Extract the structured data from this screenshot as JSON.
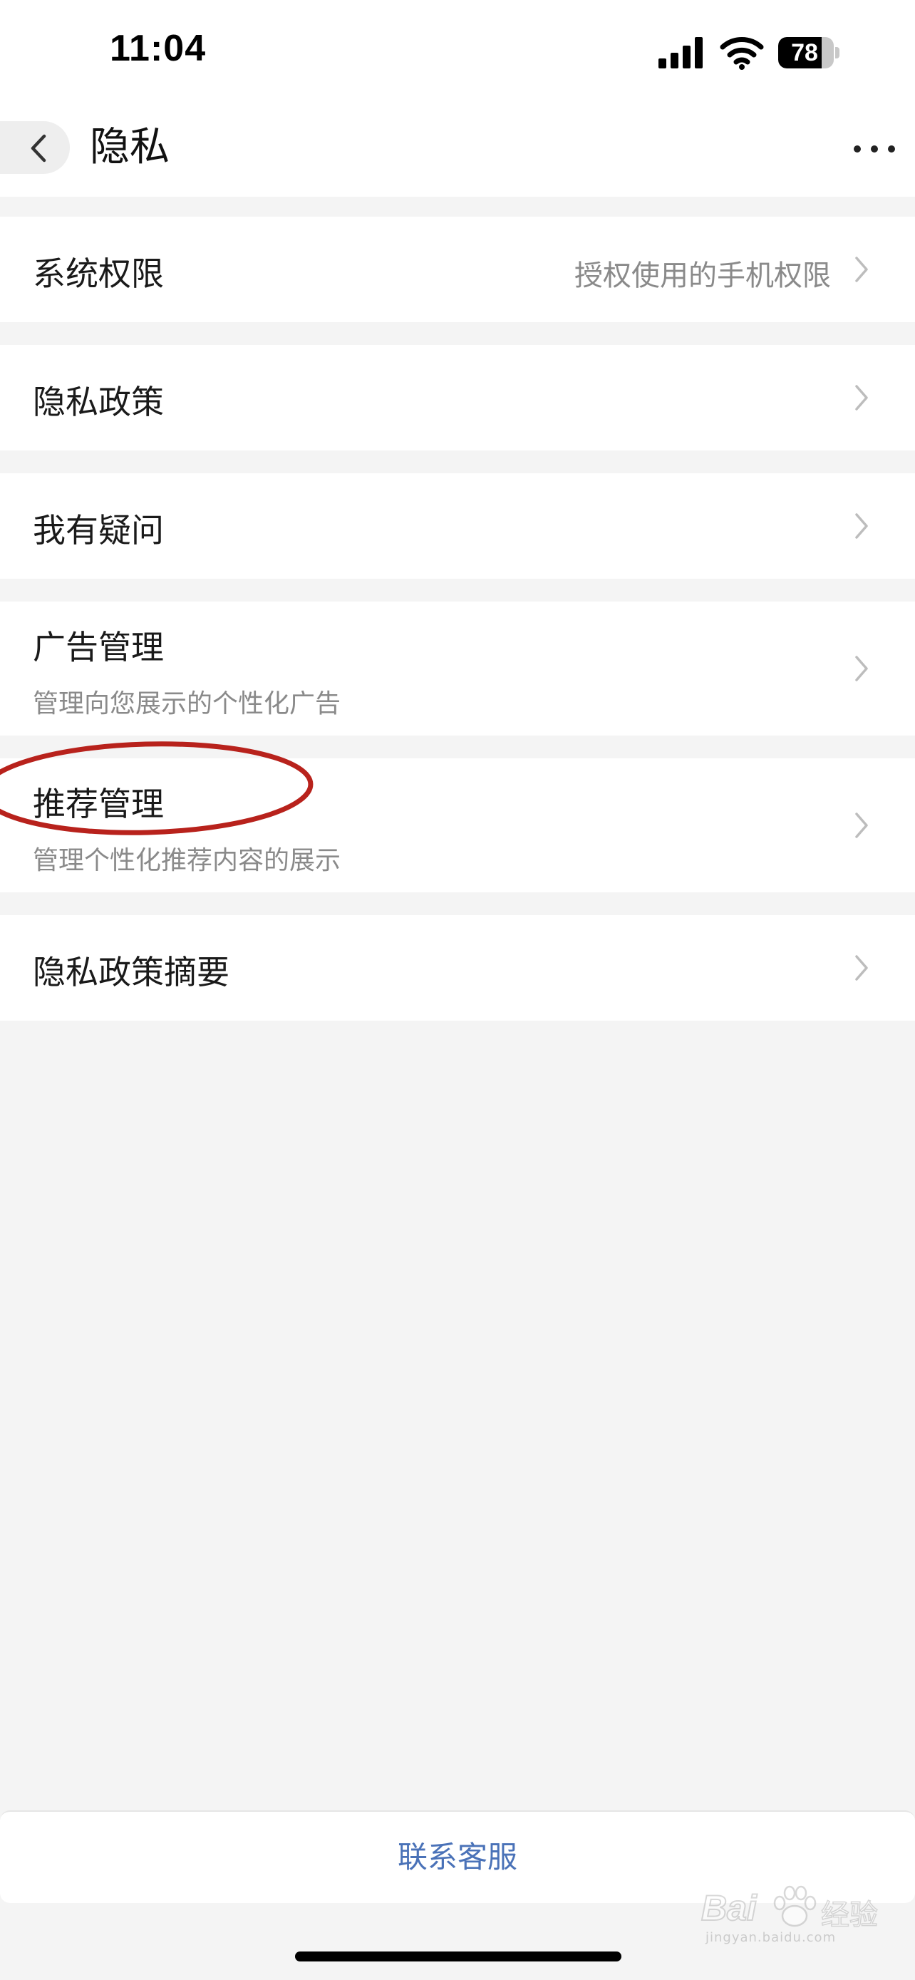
{
  "status_bar": {
    "time": "11:04",
    "battery_percent": 78,
    "battery_label": "78"
  },
  "nav": {
    "title": "隐私"
  },
  "rows": [
    {
      "title": "系统权限",
      "value": "授权使用的手机权限"
    },
    {
      "title": "隐私政策"
    },
    {
      "title": "我有疑问"
    },
    {
      "title": "广告管理",
      "subtitle": "管理向您展示的个性化广告"
    },
    {
      "title": "推荐管理",
      "subtitle": "管理个性化推荐内容的展示"
    },
    {
      "title": "隐私政策摘要"
    }
  ],
  "footer": {
    "contact_label": "联系客服"
  },
  "watermark": {
    "brand": "Bai",
    "suffix": "经验",
    "url": "jingyan.baidu.com"
  },
  "colors": {
    "background": "#f4f4f4",
    "link": "#4a72b8",
    "annotation": "#b8221c"
  }
}
